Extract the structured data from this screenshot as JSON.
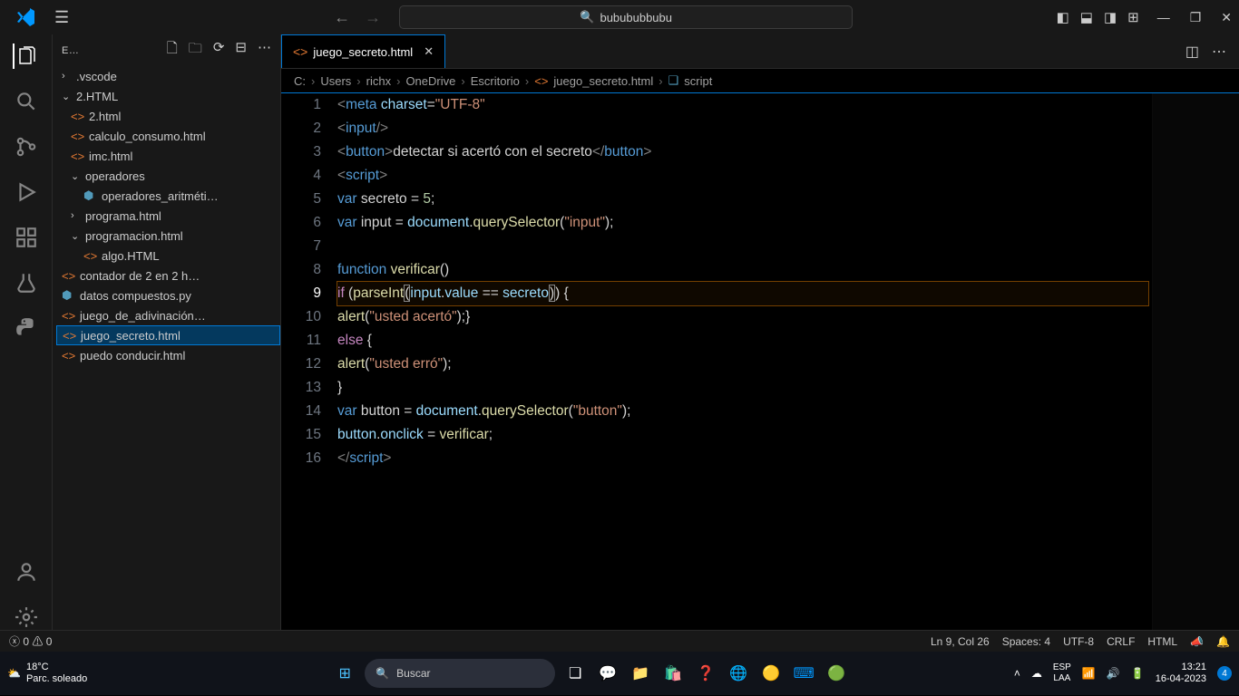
{
  "title_search": "bubububbubu",
  "sidebar_title": "E…",
  "tree": {
    "vscode": ".vscode",
    "html_folder": "2.HTML",
    "f1": "2.html",
    "f2": "calculo_consumo.html",
    "f3": "imc.html",
    "ops": "operadores",
    "f4": "operadores_aritméti…",
    "f5": "programa.html",
    "prog": "programacion.html",
    "f6": "algo.HTML",
    "f7": "contador de 2 en 2 h…",
    "f8": "datos compuestos.py",
    "f9": "juego_de_adivinación…",
    "f10": "juego_secreto.html",
    "f11": "puedo conducir.html"
  },
  "tab": {
    "name": "juego_secreto.html"
  },
  "breadcrumb": {
    "p1": "C:",
    "p2": "Users",
    "p3": "richx",
    "p4": "OneDrive",
    "p5": "Escritorio",
    "p6": "juego_secreto.html",
    "p7": "script"
  },
  "code": {
    "l1a": "<",
    "l1b": "meta",
    "l1c": " ",
    "l1d": "charset",
    "l1e": "=",
    "l1f": "\"UTF-8\"",
    "l2a": "<",
    "l2b": "input",
    "l2c": "/>",
    "l3a": "<",
    "l3b": "button",
    "l3c": ">",
    "l3d": "detectar si acertó con el secreto",
    "l3e": "</",
    "l3f": "button",
    "l3g": ">",
    "l4a": "<",
    "l4b": "script",
    "l4c": ">",
    "l5a": "var",
    "l5b": " secreto = ",
    "l5c": "5",
    "l5d": ";",
    "l6a": "var",
    "l6b": " input = ",
    "l6c": "document",
    "l6d": ".",
    "l6e": "querySelector",
    "l6f": "(",
    "l6g": "\"input\"",
    "l6h": ");",
    "l8a": "function",
    "l8b": " ",
    "l8c": "verificar",
    "l8d": "()",
    "l9a": "if",
    "l9b": " (",
    "l9c": "parseInt",
    "l9d": "(",
    "l9e": "input",
    "l9f": ".",
    "l9g": "value",
    "l9h": " == ",
    "l9i": "secreto",
    "l9j": ")",
    "l9k": ") {",
    "l10a": "alert",
    "l10b": "(",
    "l10c": "\"usted acertó\"",
    "l10d": ");}",
    "l11a": "else",
    "l11b": " {",
    "l12a": "alert",
    "l12b": "(",
    "l12c": "\"usted erró\"",
    "l12d": ");",
    "l13a": "}",
    "l14a": "var",
    "l14b": " button = ",
    "l14c": "document",
    "l14d": ".",
    "l14e": "querySelector",
    "l14f": "(",
    "l14g": "\"button\"",
    "l14h": ");",
    "l15a": "button",
    "l15b": ".",
    "l15c": "onclick",
    "l15d": " = ",
    "l15e": "verificar",
    "l15f": ";",
    "l16a": "</",
    "l16b": "script",
    "l16c": ">"
  },
  "lines": [
    "1",
    "2",
    "3",
    "4",
    "5",
    "6",
    "7",
    "8",
    "9",
    "10",
    "11",
    "12",
    "13",
    "14",
    "15",
    "16"
  ],
  "status": {
    "errors": "0",
    "warnings": "0",
    "pos": "Ln 9, Col 26",
    "spaces": "Spaces: 4",
    "enc": "UTF-8",
    "eol": "CRLF",
    "lang": "HTML"
  },
  "taskbar": {
    "temp": "18°C",
    "cond": "Parc. soleado",
    "search": "Buscar",
    "lang1": "ESP",
    "lang2": "LAA",
    "time": "13:21",
    "date": "16-04-2023"
  }
}
